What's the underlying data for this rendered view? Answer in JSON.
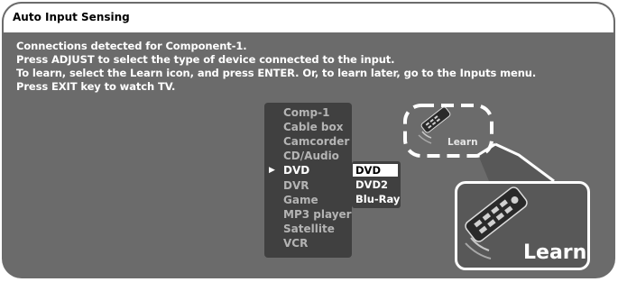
{
  "title": "Auto Input Sensing",
  "messages": [
    "Connections detected for Component-1.",
    "Press ADJUST to select the type of device connected to the input.",
    "To learn, select the Learn icon, and press ENTER.  Or, to learn later, go to the Inputs menu.",
    "Press EXIT key to watch TV."
  ],
  "device_list": {
    "items": [
      "Comp-1",
      "Cable box",
      "Camcorder",
      "CD/Audio",
      "DVD",
      "DVR",
      "Game",
      "MP3 player",
      "Satellite",
      "VCR"
    ],
    "selected": "DVD",
    "pointer": "▶"
  },
  "sub_list": {
    "items": [
      "DVD",
      "DVD2",
      "Blu-Ray"
    ],
    "highlighted": "DVD"
  },
  "learn_icon": {
    "label": "Learn",
    "icon": "remote-control-icon"
  },
  "learn_callout": {
    "label": "Learn",
    "icon": "remote-control-icon"
  },
  "colors": {
    "screen_bg": "#6b6b6b",
    "panel_bg": "#404040",
    "text_white": "#ffffff",
    "text_dim": "#b4b4b4"
  }
}
